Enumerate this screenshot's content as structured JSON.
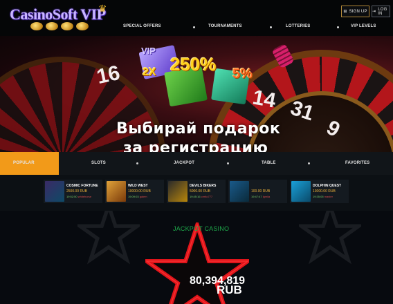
{
  "header": {
    "logo_text": "CasinoSoft VIP",
    "signup_label": "SIGN UP",
    "login_label": "LOG IN",
    "nav": [
      "SPECIAL OFFERS",
      "TOURNAMENTS",
      "LOTTERIES",
      "VIP LEVELS"
    ]
  },
  "hero": {
    "promo_1": "250%",
    "promo_2": "2X",
    "promo_3": "5%",
    "promo_badge": "VIP",
    "line1": "Выбирай подарок",
    "line2": "за регистрацию",
    "numbers": [
      "16",
      "14",
      "31",
      "9"
    ]
  },
  "tabs": {
    "items": [
      "POPULAR",
      "SLOTS",
      "JACKPOT",
      "TABLE",
      "FAVORITES"
    ],
    "active": "POPULAR"
  },
  "games": [
    {
      "title": "COSMIC FORTUNE",
      "amount": "2500.00 RUB",
      "time": "19:52:50",
      "user": "whitehorse"
    },
    {
      "title": "WILD WEST",
      "amount": "10000.00 RUB",
      "time": "19:09:03",
      "user": "galem"
    },
    {
      "title": "DEVILS BIKERS",
      "amount": "5000.00 RUB",
      "time": "19:45:16",
      "user": "cerito777"
    },
    {
      "title": "",
      "amount": "100.00 RUB",
      "time": "19:47:47",
      "user": "lgmila"
    },
    {
      "title": "DOLPHIN QUEST",
      "amount": "13000.00 RUB",
      "time": "19:35:05",
      "user": "master"
    }
  ],
  "jackpot": {
    "title": "JACKPOT CASINO",
    "amount": "80,394,819",
    "currency": "RUB"
  },
  "colors": {
    "accent": "#f29a19",
    "jackpot_green": "#1ea84a",
    "amount_gold": "#f0b43a",
    "star_red": "#e0141a"
  }
}
